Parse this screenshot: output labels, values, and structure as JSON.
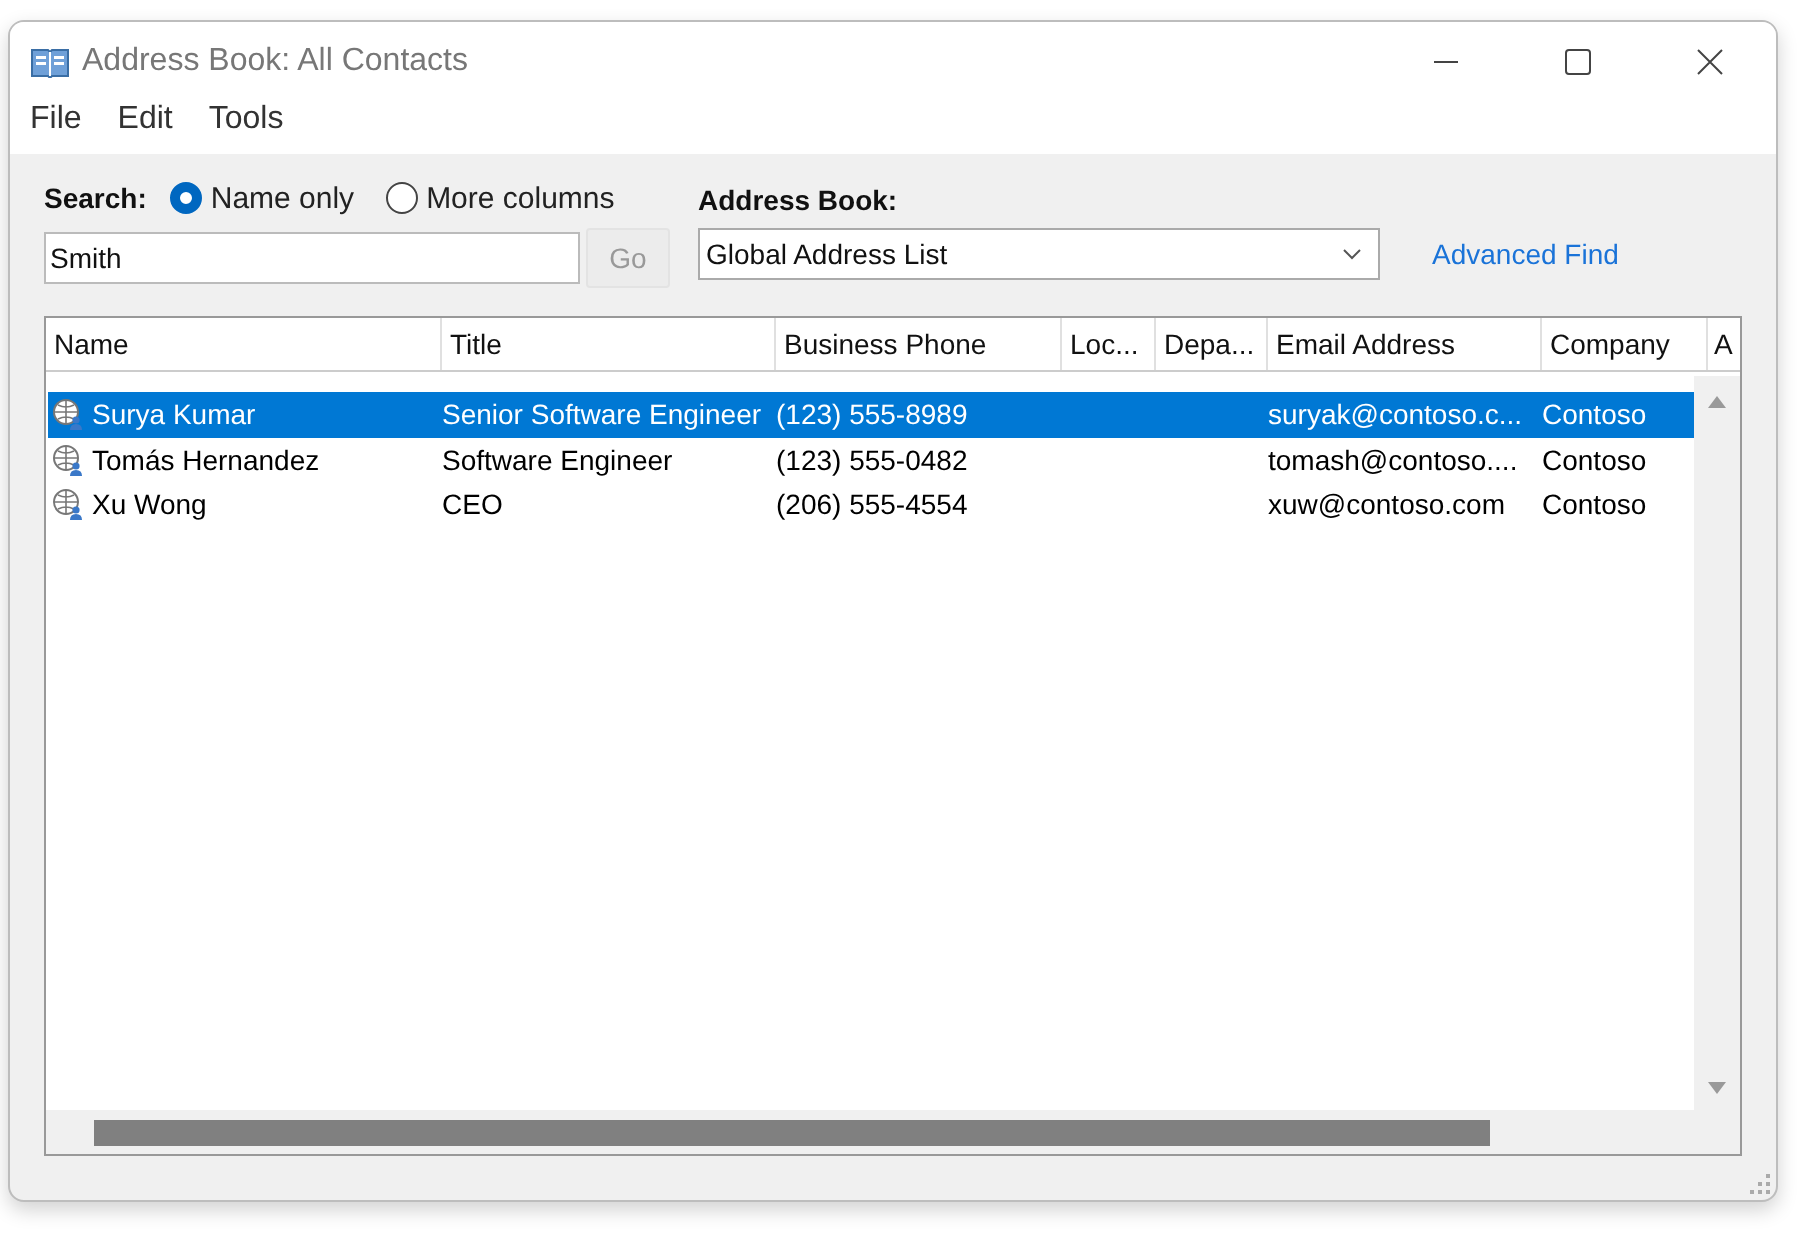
{
  "window": {
    "title": "Address Book: All Contacts"
  },
  "menu": [
    "File",
    "Edit",
    "Tools"
  ],
  "search": {
    "label": "Search:",
    "options": [
      {
        "label": "Name only",
        "selected": true
      },
      {
        "label": "More columns",
        "selected": false
      }
    ],
    "value": "Smith",
    "go": {
      "label": "Go",
      "disabled": true
    }
  },
  "address_book": {
    "label": "Address Book:",
    "value": "Global Address List"
  },
  "advanced_find": "Advanced Find",
  "table": {
    "columns": [
      "Name",
      "Title",
      "Business Phone",
      "Loc...",
      "Depa...",
      "Email Address",
      "Company",
      "A"
    ],
    "rows": [
      {
        "selected": true,
        "cells": [
          "Surya Kumar",
          "Senior Software Engineer",
          "(123) 555-8989",
          "",
          "",
          "suryak@contoso.c...",
          "Contoso"
        ]
      },
      {
        "selected": false,
        "cells": [
          "Tomás Hernandez",
          "Software Engineer",
          "(123) 555-0482",
          "",
          "",
          "tomash@contoso....",
          "Contoso"
        ]
      },
      {
        "selected": false,
        "cells": [
          "Xu Wong",
          "CEO",
          "(206) 555-4554",
          "",
          "",
          "xuw@contoso.com",
          "Contoso"
        ]
      }
    ]
  }
}
